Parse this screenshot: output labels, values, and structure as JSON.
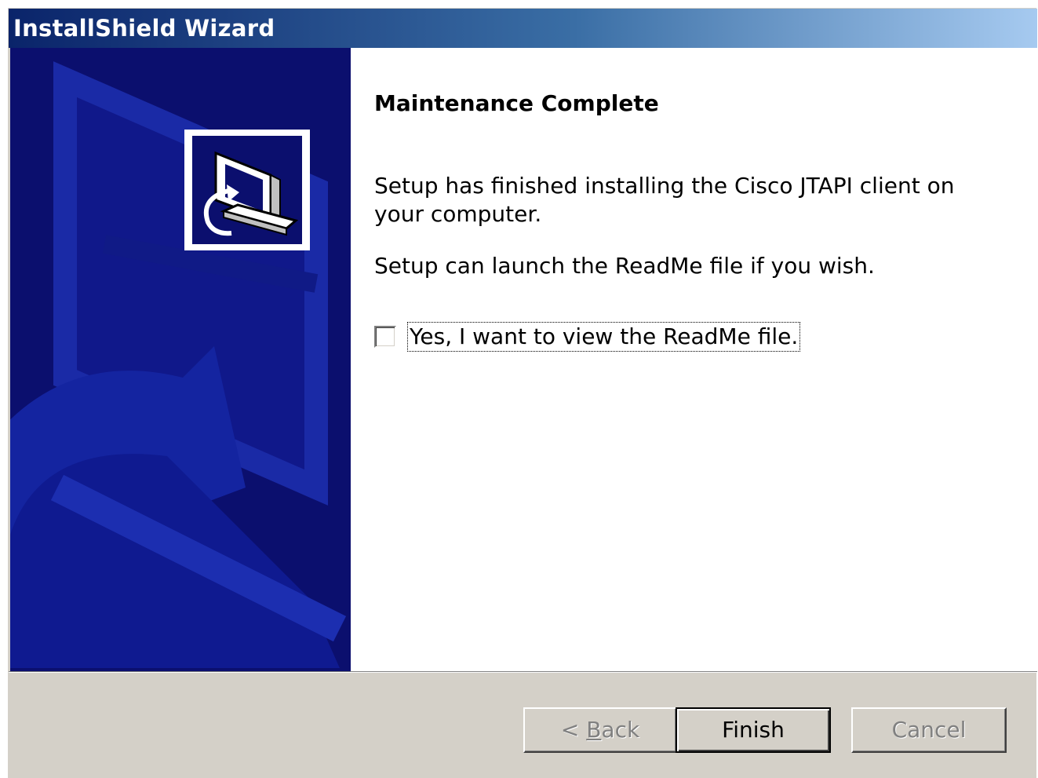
{
  "window": {
    "title": "InstallShield Wizard"
  },
  "content": {
    "heading": "Maintenance Complete",
    "paragraph1": "Setup has finished installing the Cisco JTAPI client on your computer.",
    "paragraph2": "Setup can launch the ReadMe file if you wish.",
    "readme_checkbox": {
      "label": "Yes, I want to view the ReadMe file.",
      "checked": false
    }
  },
  "buttons": {
    "back": {
      "prefix": "< ",
      "accel": "B",
      "rest": "ack",
      "enabled": false
    },
    "finish": {
      "label": "Finish",
      "enabled": true
    },
    "cancel": {
      "label": "Cancel",
      "enabled": false
    }
  },
  "icons": {
    "side_logo": "computer-install-icon"
  },
  "colors": {
    "title_start": "#0a246a",
    "title_end": "#a6caf0",
    "side_panel": "#0b0f6e",
    "face": "#d4d0c8"
  }
}
